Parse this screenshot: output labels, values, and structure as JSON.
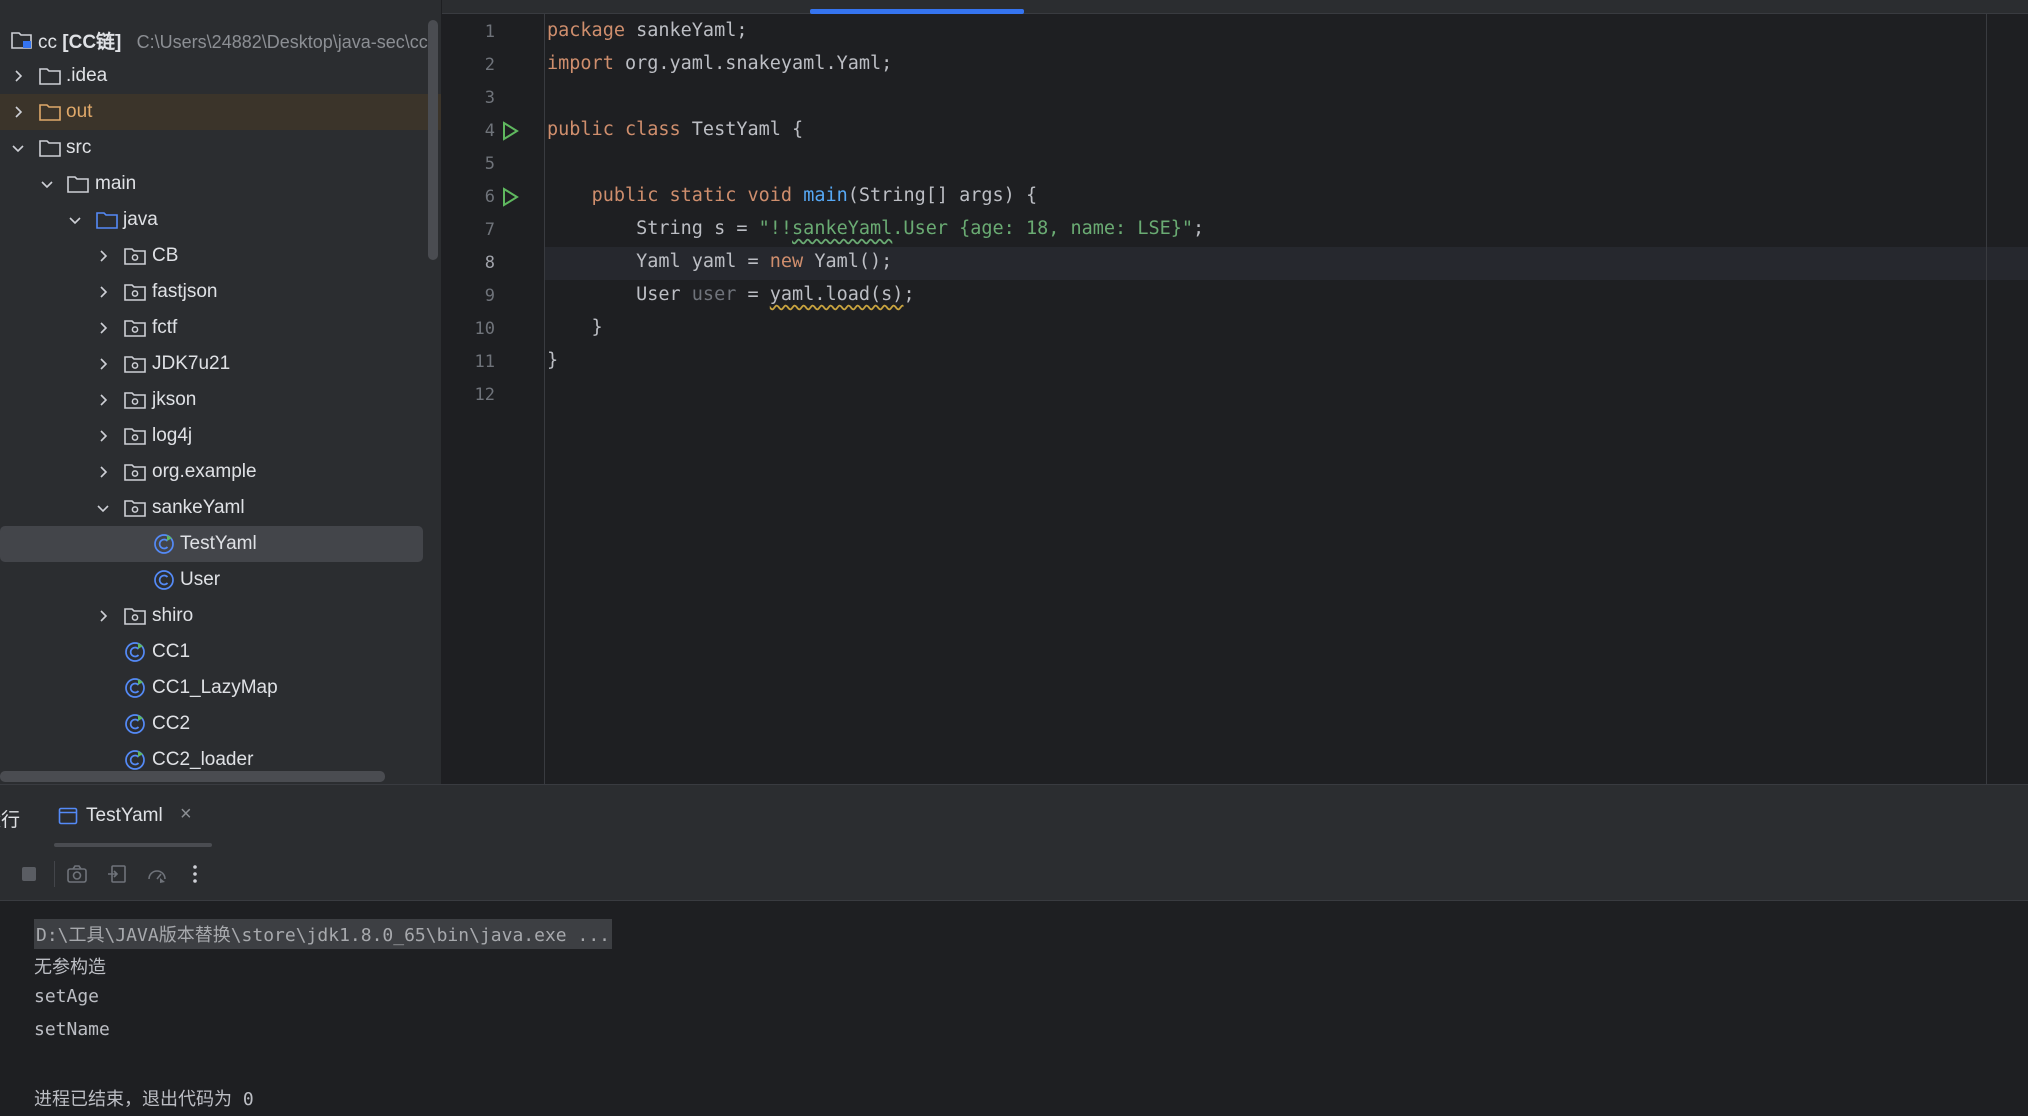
{
  "project": {
    "root": {
      "name": "cc",
      "module": "[CC链]",
      "path": "C:\\Users\\24882\\Desktop\\java-sec\\cc"
    },
    "items": [
      {
        "label": ".idea",
        "kind": "folder",
        "expanded": false
      },
      {
        "label": "out",
        "kind": "folder-excluded",
        "expanded": false
      },
      {
        "label": "src",
        "kind": "folder",
        "expanded": true
      },
      {
        "label": "main",
        "kind": "folder",
        "expanded": true
      },
      {
        "label": "java",
        "kind": "source-root",
        "expanded": true
      },
      {
        "label": "CB",
        "kind": "package",
        "expanded": false
      },
      {
        "label": "fastjson",
        "kind": "package",
        "expanded": false
      },
      {
        "label": "fctf",
        "kind": "package",
        "expanded": false
      },
      {
        "label": "JDK7u21",
        "kind": "package",
        "expanded": false
      },
      {
        "label": "jkson",
        "kind": "package",
        "expanded": false
      },
      {
        "label": "log4j",
        "kind": "package",
        "expanded": false
      },
      {
        "label": "org.example",
        "kind": "package",
        "expanded": false
      },
      {
        "label": "sankeYaml",
        "kind": "package",
        "expanded": true
      },
      {
        "label": "TestYaml",
        "kind": "class-runnable",
        "selected": true
      },
      {
        "label": "User",
        "kind": "class"
      },
      {
        "label": "shiro",
        "kind": "package",
        "expanded": false
      },
      {
        "label": "CC1",
        "kind": "class-runnable"
      },
      {
        "label": "CC1_LazyMap",
        "kind": "class-runnable"
      },
      {
        "label": "CC2",
        "kind": "class-runnable"
      },
      {
        "label": "CC2_loader",
        "kind": "class-runnable"
      }
    ]
  },
  "editor": {
    "current_line": 8,
    "line_numbers": [
      "1",
      "2",
      "3",
      "4",
      "5",
      "6",
      "7",
      "8",
      "9",
      "10",
      "11",
      "12"
    ],
    "code": {
      "l1_kw": "package",
      "l1_rest": " sankeYaml;",
      "l2_kw": "import",
      "l2_rest": " org.yaml.snakeyaml.Yaml;",
      "l4_kw": "public class",
      "l4_rest": " TestYaml {",
      "l6_indent": "    ",
      "l6_kw": "public static void",
      "l6_sp": " ",
      "l6_fn": "main",
      "l6_rest": "(String[] args) {",
      "l7_a": "        String s = ",
      "l7_s1": "\"!!",
      "l7_s2": "sankeYaml",
      "l7_s3": ".User {age: 18, name: LSE}\"",
      "l7_b": ";",
      "l8_a": "        Yaml yaml = ",
      "l8_kw": "new",
      "l8_b": " Yaml();",
      "l9_a": "        User ",
      "l9_unused": "user",
      "l9_b": " = ",
      "l9_warn": "yaml.load(s)",
      "l9_c": ";",
      "l10": "    }",
      "l11": "}"
    }
  },
  "run": {
    "title": "运行",
    "tab_label": "TestYaml",
    "tab_close": "×",
    "toolbar_icons": [
      "stop-icon",
      "screenshot-icon",
      "restore-layout-icon",
      "profiler-icon",
      "more-icon"
    ],
    "console": [
      "D:\\工具\\JAVA版本替换\\store\\jdk1.8.0_65\\bin\\java.exe ...",
      "无参构造",
      "setAge",
      "setName",
      "",
      "进程已结束，退出代码为 0"
    ]
  },
  "colors": {
    "accent": "#3574f0",
    "keyword": "#cf8e6d",
    "string": "#6aab73",
    "function": "#56a8f5",
    "run_green": "#5fb85f"
  }
}
